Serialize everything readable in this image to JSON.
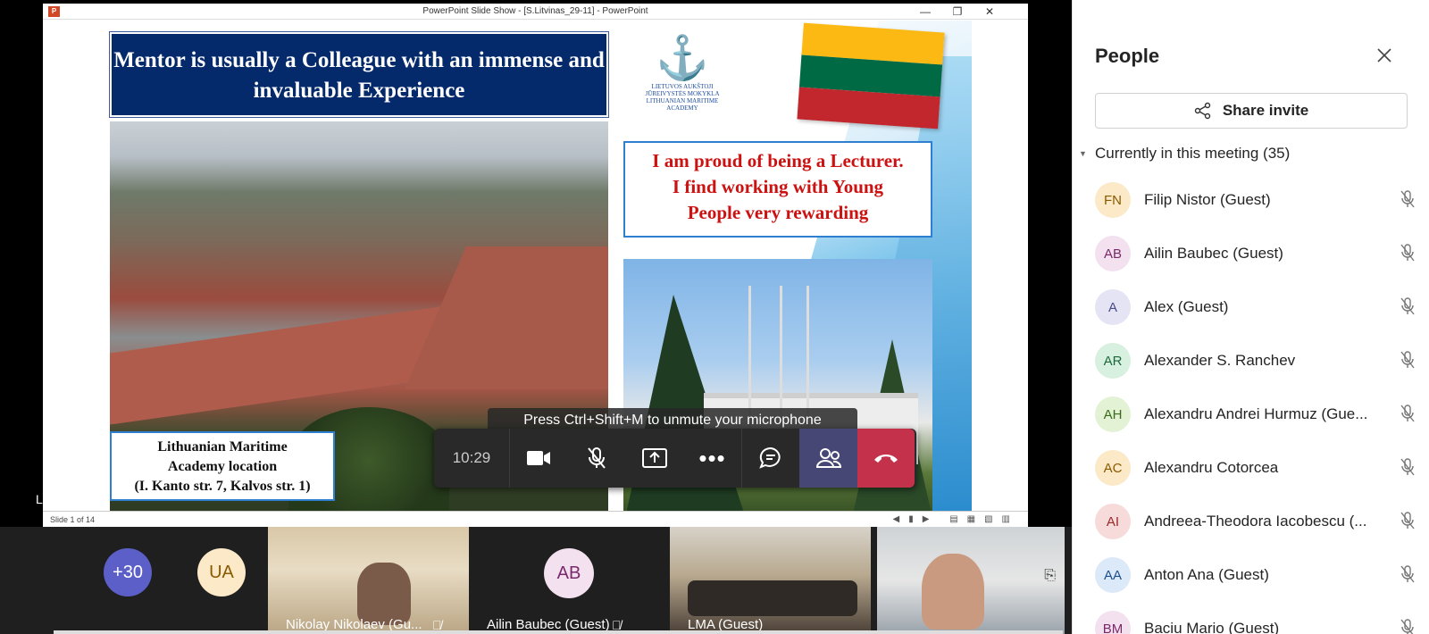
{
  "ppt": {
    "window_title": "PowerPoint Slide Show - [S.Litvinas_29-11] - PowerPoint",
    "app_icon": "P",
    "minimize": "—",
    "restore": "❐",
    "close": "✕",
    "slide_number": "Slide 1 of 14"
  },
  "slide": {
    "title": "Mentor is usually a Colleague with an immense and invaluable  Experience",
    "caption_line1": "Lithuanian Maritime",
    "caption_line2": "Academy location",
    "caption_line3": "(I. Kanto str. 7, Kalvos str. 1)",
    "quote_line1": "I am proud of being a Lecturer.",
    "quote_line2": "I find working with Young",
    "quote_line3": "People very rewarding",
    "logo_line1": "LIETUVOS AUKŠTOJI",
    "logo_line2": "JŪREIVYSTĖS MOKYKLA",
    "logo_line3": "LITHUANIAN MARITIME",
    "logo_line4": "ACADEMY",
    "flag_colors": [
      "#fdb913",
      "#006a44",
      "#c1272d"
    ]
  },
  "meeting": {
    "unmute_hint": "Press Ctrl+Shift+M to unmute your microphone",
    "timer": "10:29",
    "presenter_label": "LMA (Guest)",
    "accent": "#464775",
    "leave_color": "#c4314b"
  },
  "tiles": {
    "overflow_count": "+30",
    "ua_initials": "UA",
    "nikolay": "Nikolay Nikolaev (Gu...",
    "ab_initials": "AB",
    "ailin": "Ailin Baubec (Guest)",
    "lma": "LMA (Guest)"
  },
  "panel": {
    "title": "People",
    "share": "Share invite",
    "section": "Currently in this meeting",
    "count": "(35)",
    "people": [
      {
        "initials": "FN",
        "name": "Filip Nistor (Guest)",
        "bg": "#fbe9c8",
        "fg": "#8a5a00"
      },
      {
        "initials": "AB",
        "name": "Ailin Baubec (Guest)",
        "bg": "#f3e1ef",
        "fg": "#7a2a6a"
      },
      {
        "initials": "A",
        "name": "Alex (Guest)",
        "bg": "#e4e4f5",
        "fg": "#4a4a8a"
      },
      {
        "initials": "AR",
        "name": "Alexander S. Ranchev",
        "bg": "#d8f0e0",
        "fg": "#1b6b3a"
      },
      {
        "initials": "AH",
        "name": "Alexandru Andrei Hurmuz (Gue...",
        "bg": "#e3f2d5",
        "fg": "#3a6a1a"
      },
      {
        "initials": "AC",
        "name": "Alexandru Cotorcea",
        "bg": "#fbe9c8",
        "fg": "#8a5a00"
      },
      {
        "initials": "AI",
        "name": "Andreea-Theodora Iacobescu (...",
        "bg": "#f7dada",
        "fg": "#9a2a2a"
      },
      {
        "initials": "AA",
        "name": "Anton Ana (Guest)",
        "bg": "#dbe9f8",
        "fg": "#1d4f8a"
      },
      {
        "initials": "BM",
        "name": "Baciu Mario (Guest)",
        "bg": "#f3e1ef",
        "fg": "#7a2a6a"
      }
    ]
  }
}
